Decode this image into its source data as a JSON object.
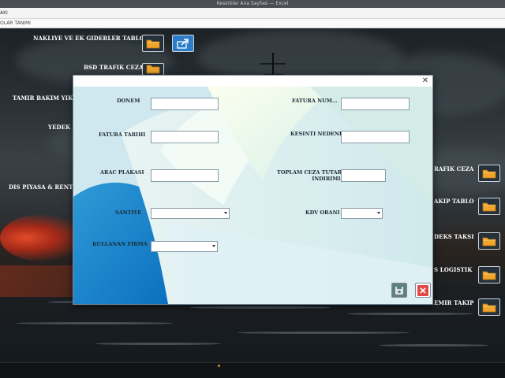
{
  "window": {
    "title": "Kesintiler Ana Sayfasi — Excel",
    "menu_label": "AKI",
    "tab_label": "OLAR TANIMI"
  },
  "background_labels": {
    "nakliye": "NAKLIYE VE EK GIDERLER TABLOSU",
    "bsd_trafik": "BSD TRAFIK CEZA",
    "tamir_bakim": "TAMIR BAKIM YIKAM",
    "yedek": "YEDEK P",
    "dis_piyasa": "DIS PIYASA & RENTMO",
    "trafik_ceza": "RAFIK CEZA",
    "takip_tablo": "AKIP TABLO",
    "deks_taksi": "DEKS TAKSI",
    "logistik": "S LOGISTIK",
    "emir_takip": "EMIR TAKIP"
  },
  "form": {
    "labels": {
      "donem": "DONEM",
      "fatura_num": "FATURA NUM…",
      "fatura_tarihi": "FATURA TARIHI",
      "kesinti_nedeni": "KESINTI NEDENI",
      "arac_plakasi": "ARAC PLAKASI",
      "toplam_ceza_line1": "TOPLAM CEZA TUTARI",
      "toplam_ceza_line2": "INDIRIMLI",
      "santiye": "SANTIYE",
      "kdv_orani": "KDV ORANI",
      "kullanan_firma": "KULLANAN FIRMA"
    },
    "values": {
      "donem": "",
      "fatura_num": "",
      "fatura_tarihi": "",
      "kesinti_nedeni": "",
      "arac_plakasi": "",
      "toplam_ceza": "",
      "santiye": "",
      "kdv_orani": "",
      "kullanan_firma": ""
    }
  },
  "icons": {
    "folder": "folder-icon",
    "share": "share-arrow-icon",
    "save": "save-icon",
    "cancel": "cancel-icon",
    "close": "close-icon"
  },
  "colors": {
    "folder": "#f0a52a",
    "share_bg": "#2b7cc9",
    "save_bg": "#5f7f80",
    "cancel_bg": "#e04848",
    "dialog_border": "#7a8c9a"
  }
}
